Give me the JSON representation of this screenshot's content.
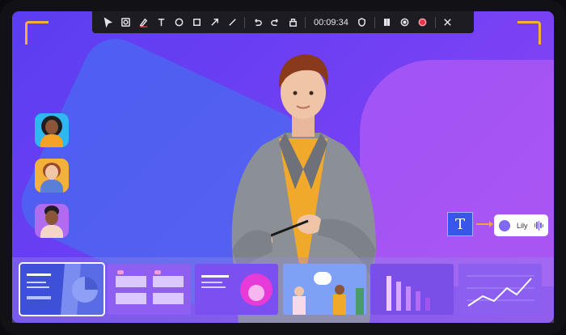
{
  "toolbar": {
    "timer": "00:09:34",
    "tools": [
      "cursor-icon",
      "screen-record-icon",
      "pen-icon",
      "text-icon",
      "circle-icon",
      "rectangle-icon",
      "arrow-icon",
      "line-icon",
      "undo-icon",
      "redo-icon",
      "clear-icon"
    ],
    "colors": {
      "record": "#e8324a",
      "bar": "#1c1c22"
    }
  },
  "avatars": [
    {
      "name": "avatar-1",
      "bg": "#2fb8f0"
    },
    {
      "name": "avatar-2",
      "bg": "#f2b13a"
    },
    {
      "name": "avatar-3",
      "bg": "#b16bf0"
    }
  ],
  "text_tool": {
    "glyph": "T"
  },
  "speaker_tag": {
    "name": "Lily"
  },
  "thumbnails": [
    {
      "name": "slide-thumb-1",
      "selected": true
    },
    {
      "name": "slide-thumb-2",
      "selected": false
    },
    {
      "name": "slide-thumb-3",
      "selected": false
    },
    {
      "name": "slide-thumb-4",
      "selected": false
    },
    {
      "name": "slide-thumb-5",
      "selected": false
    },
    {
      "name": "slide-thumb-6",
      "selected": false
    }
  ],
  "accent": {
    "corner": "#f2b13a",
    "bg_start": "#5b3df1",
    "bg_end": "#8f45f5"
  }
}
